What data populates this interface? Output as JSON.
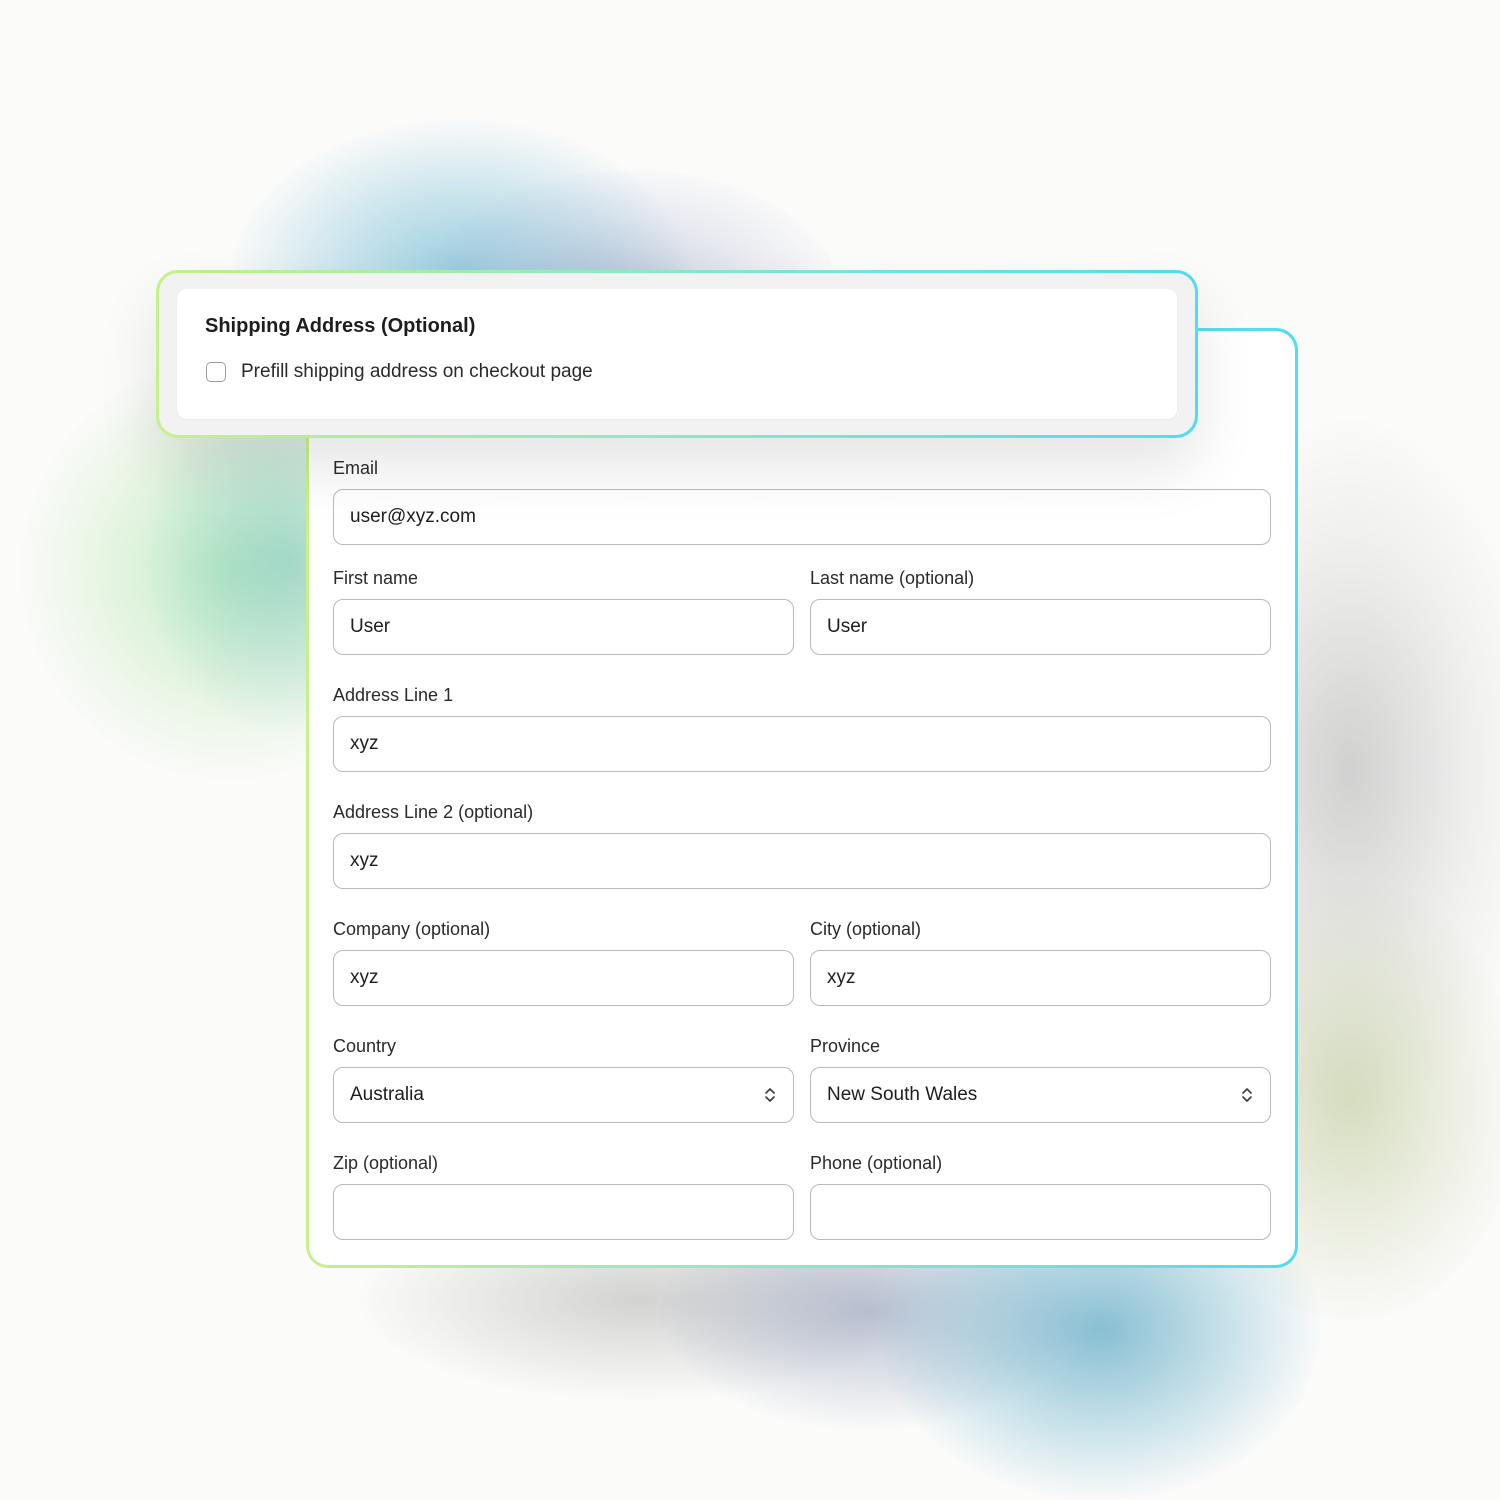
{
  "colors": {
    "border_gradient_start": "#c6f08b",
    "border_gradient_end": "#52dcf0",
    "input_border": "#b9b9be",
    "text": "#1d1d1f"
  },
  "shipping": {
    "title": "Shipping Address (Optional)",
    "prefill_checkbox": {
      "label": "Prefill shipping address on checkout page",
      "checked": false
    }
  },
  "form": {
    "email": {
      "label": "Email",
      "value": "user@xyz.com"
    },
    "first_name": {
      "label": "First name",
      "value": "User"
    },
    "last_name": {
      "label": "Last name (optional)",
      "value": "User"
    },
    "address_line_1": {
      "label": "Address Line 1",
      "value": "xyz"
    },
    "address_line_2": {
      "label": "Address Line 2 (optional)",
      "value": "xyz"
    },
    "company": {
      "label": "Company (optional)",
      "value": "xyz"
    },
    "city": {
      "label": "City (optional)",
      "value": "xyz"
    },
    "country": {
      "label": "Country",
      "value": "Australia",
      "icon": "chevron-up-down-icon"
    },
    "province": {
      "label": "Province",
      "value": "New South Wales",
      "icon": "chevron-up-down-icon"
    },
    "zip": {
      "label": "Zip (optional)",
      "value": ""
    },
    "phone": {
      "label": "Phone (optional)",
      "value": ""
    }
  }
}
